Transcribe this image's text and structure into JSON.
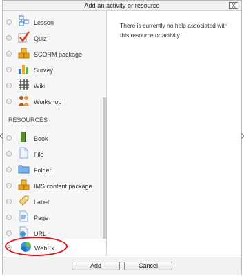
{
  "dialog": {
    "title": "Add an activity or resource",
    "close_label": "X"
  },
  "activities": [
    {
      "label": "Lesson",
      "icon": "lesson-icon"
    },
    {
      "label": "Quiz",
      "icon": "quiz-icon"
    },
    {
      "label": "SCORM package",
      "icon": "scorm-icon"
    },
    {
      "label": "Survey",
      "icon": "survey-icon"
    },
    {
      "label": "Wiki",
      "icon": "wiki-icon"
    },
    {
      "label": "Workshop",
      "icon": "workshop-icon"
    }
  ],
  "resources_heading": "RESOURCES",
  "resources": [
    {
      "label": "Book",
      "icon": "book-icon"
    },
    {
      "label": "File",
      "icon": "file-icon"
    },
    {
      "label": "Folder",
      "icon": "folder-icon"
    },
    {
      "label": "IMS content package",
      "icon": "ims-icon"
    },
    {
      "label": "Label",
      "icon": "label-icon"
    },
    {
      "label": "Page",
      "icon": "page-icon"
    },
    {
      "label": "URL",
      "icon": "url-icon"
    },
    {
      "label": "WebEx",
      "icon": "webex-icon",
      "selected": true
    }
  ],
  "help_text": "There is currently no help associated with this resource or activity",
  "buttons": {
    "add": "Add",
    "cancel": "Cancel"
  },
  "colors": {
    "highlight": "#e0131a"
  }
}
